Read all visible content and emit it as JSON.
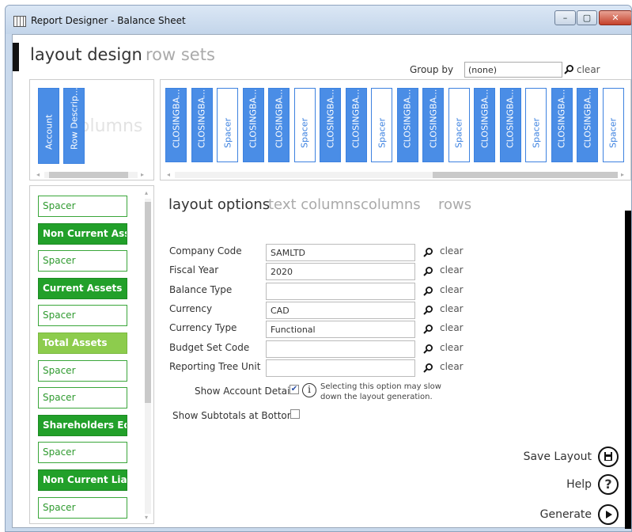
{
  "window": {
    "title": "Report Designer - Balance Sheet",
    "min": "–",
    "max": "▢",
    "close": "✕"
  },
  "header": {
    "tab_active": "layout design",
    "tab_inactive": "row sets"
  },
  "groupby": {
    "label": "Group by",
    "value": "(none)",
    "clear": "clear"
  },
  "text_columns": {
    "items": [
      "Account",
      "Row Descrip..."
    ],
    "watermark": "olumns"
  },
  "columns": {
    "items": [
      {
        "label": "CLOSINGBA...",
        "style": "filled"
      },
      {
        "label": "CLOSINGBA...",
        "style": "filled"
      },
      {
        "label": "Spacer",
        "style": "outline"
      },
      {
        "label": "CLOSINGBA...",
        "style": "filled"
      },
      {
        "label": "CLOSINGBA...",
        "style": "filled"
      },
      {
        "label": "Spacer",
        "style": "outline"
      },
      {
        "label": "CLOSINGBA...",
        "style": "filled"
      },
      {
        "label": "CLOSINGBA...",
        "style": "filled"
      },
      {
        "label": "Spacer",
        "style": "outline"
      },
      {
        "label": "CLOSINGBA...",
        "style": "filled"
      },
      {
        "label": "CLOSINGBA...",
        "style": "filled"
      },
      {
        "label": "Spacer",
        "style": "outline"
      },
      {
        "label": "CLOSINGBA...",
        "style": "filled"
      },
      {
        "label": "CLOSINGBA...",
        "style": "filled"
      },
      {
        "label": "Spacer",
        "style": "outline"
      },
      {
        "label": "CLOSINGBA...",
        "style": "filled"
      },
      {
        "label": "CLOSINGBA...",
        "style": "filled"
      },
      {
        "label": "Spacer",
        "style": "outline"
      }
    ]
  },
  "rows": {
    "items": [
      {
        "label": "Spacer",
        "style": "outline"
      },
      {
        "label": "Non Current Ass...",
        "style": "filled"
      },
      {
        "label": "Spacer",
        "style": "outline"
      },
      {
        "label": "Current Assets",
        "style": "filled"
      },
      {
        "label": "Spacer",
        "style": "outline"
      },
      {
        "label": "Total Assets",
        "style": "light"
      },
      {
        "label": "Spacer",
        "style": "outline"
      },
      {
        "label": "Spacer",
        "style": "outline"
      },
      {
        "label": "Shareholders Eq...",
        "style": "filled"
      },
      {
        "label": "Spacer",
        "style": "outline"
      },
      {
        "label": "Non Current Lia...",
        "style": "filled"
      },
      {
        "label": "Spacer",
        "style": "outline"
      }
    ]
  },
  "subtabs": {
    "layout_options": "layout options",
    "text_columns": "text columns",
    "columns": "columns",
    "rows": "rows"
  },
  "fields": [
    {
      "label": "Company Code",
      "value": "SAMLTD",
      "clear": "clear"
    },
    {
      "label": "Fiscal Year",
      "value": "2020",
      "clear": "clear"
    },
    {
      "label": "Balance Type",
      "value": "",
      "clear": "clear"
    },
    {
      "label": "Currency",
      "value": "CAD",
      "clear": "clear"
    },
    {
      "label": "Currency Type",
      "value": "Functional",
      "clear": "clear"
    },
    {
      "label": "Budget Set Code",
      "value": "",
      "clear": "clear"
    },
    {
      "label": "Reporting Tree Unit",
      "value": "",
      "clear": "clear"
    }
  ],
  "options": {
    "show_account_detail": "Show Account Detail",
    "show_account_detail_checked": true,
    "info_glyph": "i",
    "info_line1": "Selecting this option may slow",
    "info_line2": "down the layout generation.",
    "show_subtotals": "Show Subtotals at Bottom",
    "show_subtotals_checked": false
  },
  "actions": {
    "save": "Save Layout",
    "help": "Help",
    "help_glyph": "?",
    "generate": "Generate"
  },
  "colors": {
    "blue": "#4a8de6",
    "green": "#22a02a",
    "light_green": "#8dcc4d"
  }
}
